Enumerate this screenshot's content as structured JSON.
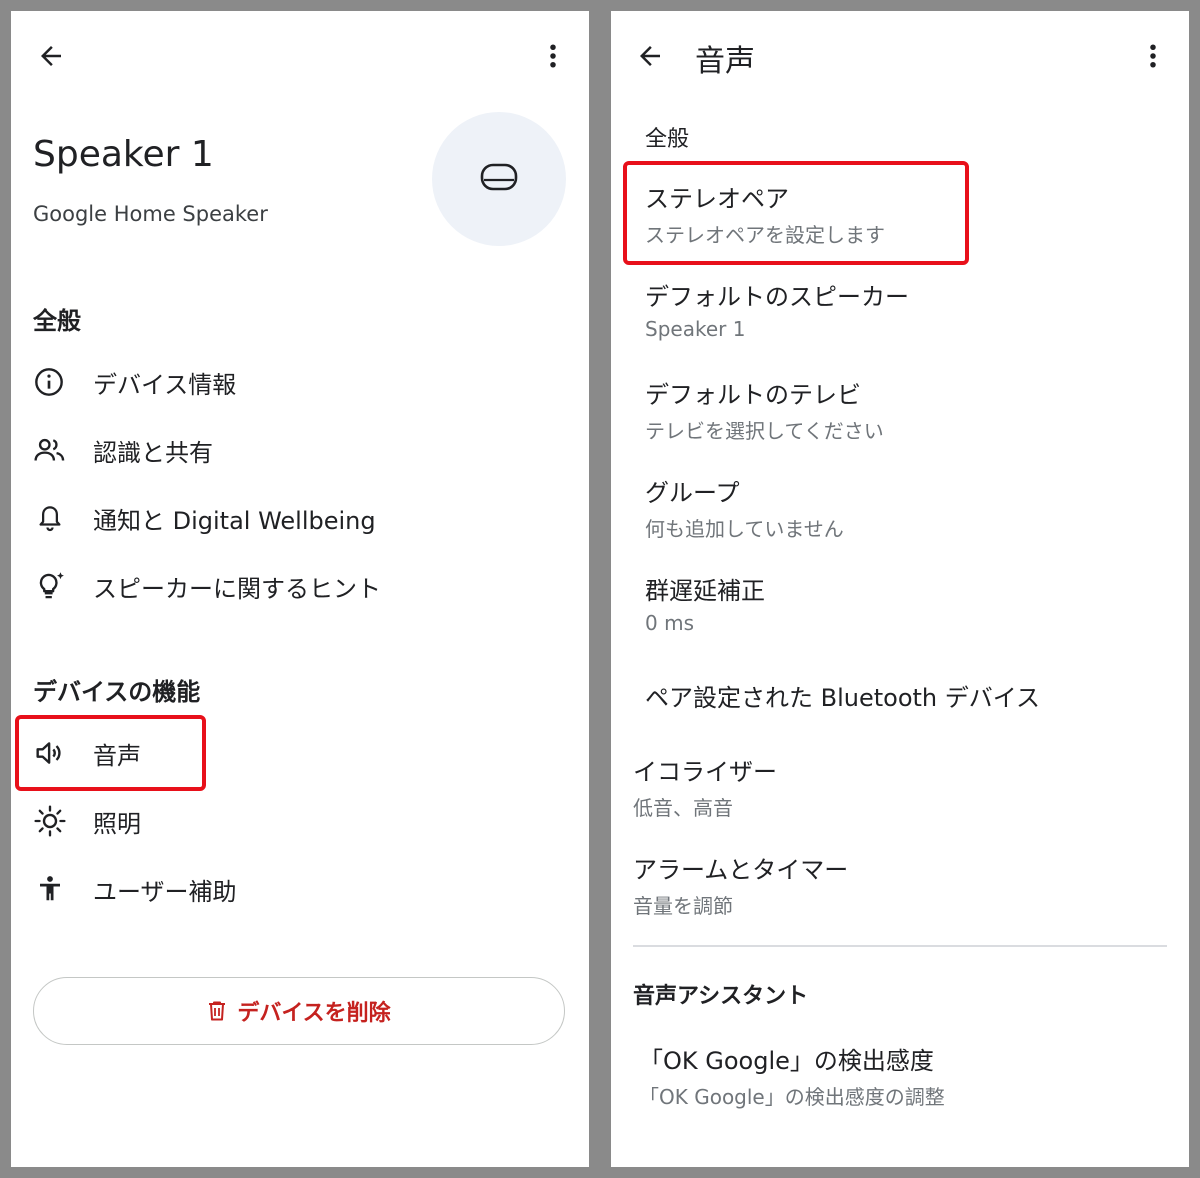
{
  "left": {
    "header": {
      "back_icon": "arrow-left-icon",
      "menu_icon": "more-vert-icon"
    },
    "device": {
      "name": "Speaker 1",
      "model": "Google Home Speaker",
      "avatar_icon": "speaker-icon"
    },
    "section_general": "全般",
    "general_items": [
      {
        "label": "デバイス情報",
        "icon": "info-icon"
      },
      {
        "label": "認識と共有",
        "icon": "people-icon"
      },
      {
        "label": "通知と Digital Wellbeing",
        "icon": "bell-icon"
      },
      {
        "label": "スピーカーに関するヒント",
        "icon": "lightbulb-icon"
      }
    ],
    "section_features": "デバイスの機能",
    "feature_items": [
      {
        "label": "音声",
        "icon": "volume-icon",
        "highlighted": true
      },
      {
        "label": "照明",
        "icon": "brightness-icon"
      },
      {
        "label": "ユーザー補助",
        "icon": "accessibility-icon"
      }
    ],
    "delete_button": {
      "label": "デバイスを削除",
      "icon": "trash-icon",
      "color": "#c5221f"
    }
  },
  "right": {
    "header": {
      "title": "音声",
      "back_icon": "arrow-left-icon",
      "menu_icon": "more-vert-icon"
    },
    "section_general": "全般",
    "items": [
      {
        "title": "ステレオペア",
        "subtitle": "ステレオペアを設定します",
        "highlighted": true
      },
      {
        "title": "デフォルトのスピーカー",
        "subtitle": "Speaker 1"
      },
      {
        "title": "デフォルトのテレビ",
        "subtitle": "テレビを選択してください"
      },
      {
        "title": "グループ",
        "subtitle": "何も追加していません"
      },
      {
        "title": "群遅延補正",
        "subtitle": "0 ms"
      },
      {
        "title": "ペア設定された Bluetooth デバイス"
      },
      {
        "title": "イコライザー",
        "subtitle": "低音、高音"
      },
      {
        "title": "アラームとタイマー",
        "subtitle": "音量を調節"
      }
    ],
    "section_assistant": "音声アシスタント",
    "assistant_items": [
      {
        "title": "「OK Google」の検出感度",
        "subtitle": "「OK Google」の検出感度の調整"
      }
    ]
  },
  "colors": {
    "highlight": "#e8101a",
    "avatar_bg": "#eef2f8",
    "secondary_text": "#70757a"
  }
}
